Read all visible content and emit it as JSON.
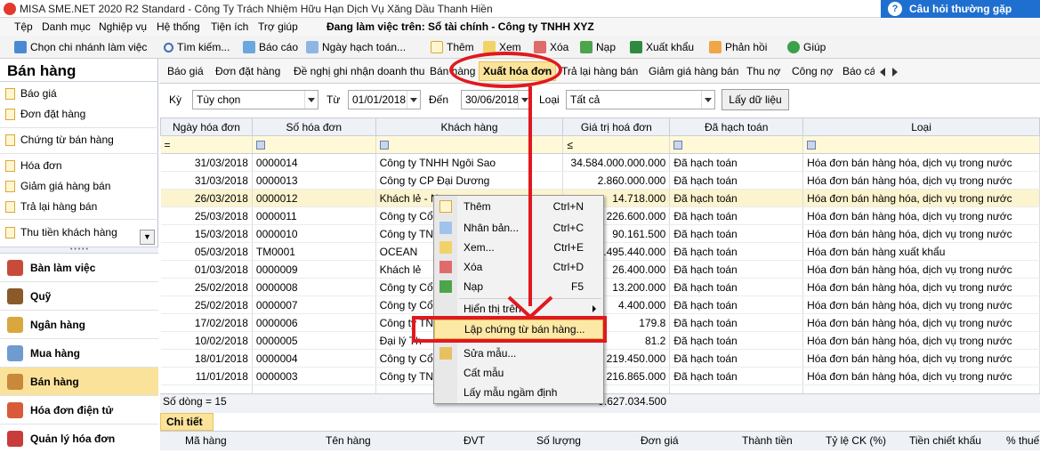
{
  "window": {
    "title": "MISA SME.NET 2020 R2 Standard - Công Ty Trách Nhiệm Hữu Hạn Dịch Vụ Xăng Dầu Thanh Hiền",
    "faq_label": "Câu hỏi thường gặp"
  },
  "menubar": {
    "items": [
      "Tệp",
      "Danh mục",
      "Nghiệp vụ",
      "Hệ thống",
      "Tiện ích",
      "Trợ giúp"
    ],
    "working_on": "Đang làm việc trên: Sổ tài chính - Công ty TNHH XYZ"
  },
  "toolbar": {
    "branch": "Chọn chi nhánh làm việc",
    "search": "Tìm kiếm...",
    "report": "Báo cáo",
    "post_date": "Ngày hạch toán...",
    "add": "Thêm",
    "view": "Xem",
    "delete": "Xóa",
    "reload": "Nạp",
    "export": "Xuất khẩu",
    "feedback": "Phản hồi",
    "help": "Giúp"
  },
  "sidebar": {
    "title": "Bán hàng",
    "items": [
      "Báo giá",
      "Đơn đặt hàng",
      "Chứng từ bán hàng",
      "Hóa đơn",
      "Giảm giá hàng bán",
      "Trả lại hàng bán",
      "Thu tiền khách hàng"
    ],
    "modules": [
      "Bàn làm việc",
      "Quỹ",
      "Ngân hàng",
      "Mua hàng",
      "Bán hàng",
      "Hóa đơn điện tử",
      "Quản lý hóa đơn"
    ],
    "active_module": "Bán hàng"
  },
  "tabs": {
    "items": [
      "Báo giá",
      "Đơn đặt hàng",
      "Đề nghị ghi nhận doanh thu",
      "Bán hàng",
      "Xuất hóa đơn",
      "Trả lại hàng bán",
      "Giảm giá hàng bán",
      "Thu nợ",
      "Công nợ",
      "Báo cáo"
    ],
    "active": "Xuất hóa đơn"
  },
  "filter": {
    "period_label": "Kỳ",
    "period_value": "Tùy chọn",
    "from_label": "Từ",
    "from_value": "01/01/2018",
    "to_label": "Đến",
    "to_value": "30/06/2018",
    "type_label": "Loại",
    "type_value": "Tất cả",
    "load_button": "Lấy dữ liệu"
  },
  "grid": {
    "columns": [
      "Ngày hóa đơn",
      "Số hóa đơn",
      "Khách hàng",
      "Giá trị hoá đơn",
      "Đã hạch toán",
      "Loại"
    ],
    "filter_row": [
      "=",
      "",
      "",
      "≤",
      "",
      ""
    ],
    "rows": [
      {
        "date": "31/03/2018",
        "no": "0000014",
        "customer": "Công ty TNHH Ngôi Sao",
        "value": "34.584.000.000.000",
        "posted": "Đã hạch toán",
        "type": "Hóa đơn bán hàng hóa, dịch vụ trong nước"
      },
      {
        "date": "31/03/2018",
        "no": "0000013",
        "customer": "Công ty CP Đại Dương",
        "value": "2.860.000.000",
        "posted": "Đã hạch toán",
        "type": "Hóa đơn bán hàng hóa, dịch vụ trong nước"
      },
      {
        "date": "26/03/2018",
        "no": "0000012",
        "customer": "Khách lẻ - N",
        "value": "14.718.000",
        "posted": "Đã hạch toán",
        "type": "Hóa đơn bán hàng hóa, dịch vụ trong nước"
      },
      {
        "date": "25/03/2018",
        "no": "0000011",
        "customer": "Công ty Cổ p",
        "value": "226.600.000",
        "posted": "Đã hạch toán",
        "type": "Hóa đơn bán hàng hóa, dịch vụ trong nước"
      },
      {
        "date": "15/03/2018",
        "no": "0000010",
        "customer": "Công ty TNH",
        "value": "90.161.500",
        "posted": "Đã hạch toán",
        "type": "Hóa đơn bán hàng hóa, dịch vụ trong nước"
      },
      {
        "date": "05/03/2018",
        "no": "TM0001",
        "customer": "OCEAN",
        "value": "1.495.440.000",
        "posted": "Đã hạch toán",
        "type": "Hóa đơn bán hàng xuất khẩu"
      },
      {
        "date": "01/03/2018",
        "no": "0000009",
        "customer": "Khách lẻ",
        "value": "26.400.000",
        "posted": "Đã hạch toán",
        "type": "Hóa đơn bán hàng hóa, dịch vụ trong nước"
      },
      {
        "date": "25/02/2018",
        "no": "0000008",
        "customer": "Công ty Cổ p",
        "value": "13.200.000",
        "posted": "Đã hạch toán",
        "type": "Hóa đơn bán hàng hóa, dịch vụ trong nước"
      },
      {
        "date": "25/02/2018",
        "no": "0000007",
        "customer": "Công ty Cổ p",
        "value": "4.400.000",
        "posted": "Đã hạch toán",
        "type": "Hóa đơn bán hàng hóa, dịch vụ trong nước"
      },
      {
        "date": "17/02/2018",
        "no": "0000006",
        "customer": "Công ty TNH",
        "value": "179.8",
        "posted": "Đã hạch toán",
        "type": "Hóa đơn bán hàng hóa, dịch vụ trong nước"
      },
      {
        "date": "10/02/2018",
        "no": "0000005",
        "customer": "Đại lý Th",
        "value": "81.2",
        "posted": "Đã hạch toán",
        "type": "Hóa đơn bán hàng hóa, dịch vụ trong nước"
      },
      {
        "date": "18/01/2018",
        "no": "0000004",
        "customer": "Công ty Cổ p",
        "value": "219.450.000",
        "posted": "Đã hạch toán",
        "type": "Hóa đơn bán hàng hóa, dịch vụ trong nước"
      },
      {
        "date": "11/01/2018",
        "no": "0000003",
        "customer": "Công ty TNH",
        "value": "216.865.000",
        "posted": "Đã hạch toán",
        "type": "Hóa đơn bán hàng hóa, dịch vụ trong nước"
      },
      {
        "date": "",
        "no": "",
        "customer": "",
        "value": "",
        "posted": "",
        "type": ""
      }
    ],
    "footer_count": "Số dòng = 15",
    "footer_total": "9.627.034.500"
  },
  "detail": {
    "tab": "Chi tiết",
    "columns": [
      "Mã hàng",
      "Tên hàng",
      "ĐVT",
      "Số lượng",
      "Đơn giá",
      "Thành tiền",
      "Tỷ lệ CK (%)",
      "Tiền chiết khấu",
      "% thuế"
    ]
  },
  "context_menu": {
    "items": [
      {
        "label": "Thêm",
        "shortcut": "Ctrl+N"
      },
      {
        "label": "Nhân bản...",
        "shortcut": "Ctrl+C"
      },
      {
        "label": "Xem...",
        "shortcut": "Ctrl+E"
      },
      {
        "label": "Xóa",
        "shortcut": "Ctrl+D"
      },
      {
        "label": "Nạp",
        "shortcut": "F5"
      },
      {
        "label": "Hiển thị trên",
        "shortcut": ""
      },
      {
        "label": "Lập chứng từ bán hàng...",
        "shortcut": ""
      },
      {
        "label": "Sửa mẫu...",
        "shortcut": ""
      },
      {
        "label": "Cất mẫu",
        "shortcut": ""
      },
      {
        "label": "Lấy mẫu ngầm định",
        "shortcut": ""
      }
    ],
    "highlighted": "Lập chứng từ bán hàng..."
  },
  "colors": {
    "accent": "#fbe39a",
    "annotation": "#e0191f",
    "faq": "#1f6fd0"
  }
}
